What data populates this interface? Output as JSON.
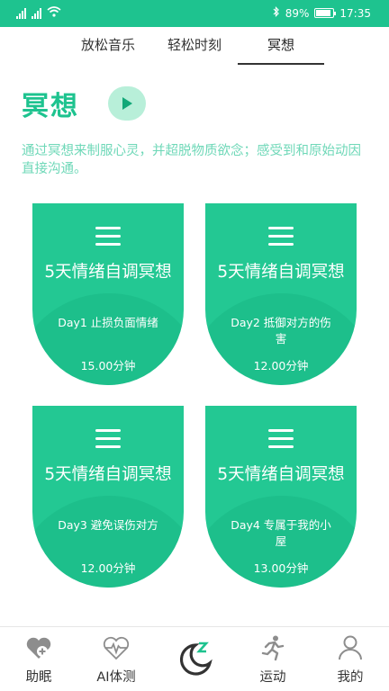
{
  "status_bar": {
    "network_1": "4G",
    "network_2": "2G",
    "battery": "89%",
    "time": "17:35"
  },
  "tabs": [
    {
      "label": "放松音乐"
    },
    {
      "label": "轻松时刻"
    },
    {
      "label": "冥想"
    }
  ],
  "page": {
    "title": "冥想",
    "description": "通过冥想来制服心灵，并超脱物质欲念；感受到和原始动因直接沟通。"
  },
  "cards": [
    {
      "title": "5天情绪自调冥想",
      "subtitle": "Day1 止损负面情绪",
      "duration": "15.00分钟"
    },
    {
      "title": "5天情绪自调冥想",
      "subtitle": "Day2 抵御对方的伤害",
      "duration": "12.00分钟"
    },
    {
      "title": "5天情绪自调冥想",
      "subtitle": "Day3 避免误伤对方",
      "duration": "12.00分钟"
    },
    {
      "title": "5天情绪自调冥想",
      "subtitle": "Day4 专属于我的小屋",
      "duration": "13.00分钟"
    }
  ],
  "bottom_nav": [
    {
      "label": "助眠",
      "icon": "heart-plus-icon"
    },
    {
      "label": "AI体测",
      "icon": "heartbeat-icon"
    },
    {
      "label": "",
      "icon": "moon-sleep-icon"
    },
    {
      "label": "运动",
      "icon": "running-icon"
    },
    {
      "label": "我的",
      "icon": "user-icon"
    }
  ],
  "colors": {
    "accent": "#1ec38f",
    "card": "#23c893",
    "play_bg": "#b8efd9",
    "description": "#6fd8b8"
  }
}
